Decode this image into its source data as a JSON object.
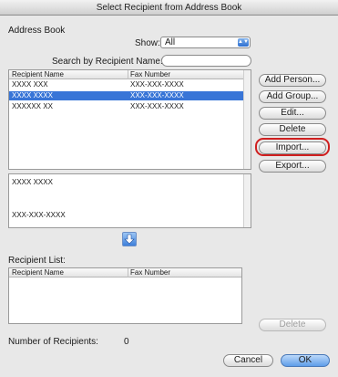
{
  "window": {
    "title": "Select Recipient from Address Book"
  },
  "address_book": {
    "heading": "Address Book",
    "show_label": "Show:",
    "show_value": "All",
    "search_label": "Search by Recipient Name:",
    "search_value": "",
    "columns": [
      "Recipient Name",
      "Fax Number"
    ],
    "rows": [
      {
        "name": "XXXX XXX",
        "fax": "XXX-XXX-XXXX",
        "selected": false
      },
      {
        "name": "XXXX XXXX",
        "fax": "XXX-XXX-XXXX",
        "selected": true
      },
      {
        "name": "XXXXXX XX",
        "fax": "XXX-XXX-XXXX",
        "selected": false
      }
    ]
  },
  "actions": {
    "add_person": "Add Person...",
    "add_group": "Add Group...",
    "edit": "Edit...",
    "delete": "Delete",
    "import": "Import...",
    "export": "Export..."
  },
  "details": {
    "name": "XXXX XXXX",
    "fax": "XXX-XXX-XXXX"
  },
  "recipient_list": {
    "heading": "Recipient List:",
    "columns": [
      "Recipient Name",
      "Fax Number"
    ],
    "delete_label": "Delete",
    "count_label": "Number of Recipients:",
    "count_value": "0"
  },
  "footer": {
    "cancel": "Cancel",
    "ok": "OK"
  },
  "colors": {
    "selection": "#3875d7",
    "highlight_ring": "#cf1f1f",
    "default_button": "#5f9ee9"
  },
  "icons": {
    "show_select": "up-down-arrows-icon",
    "add_to_list": "arrow-down-icon"
  }
}
